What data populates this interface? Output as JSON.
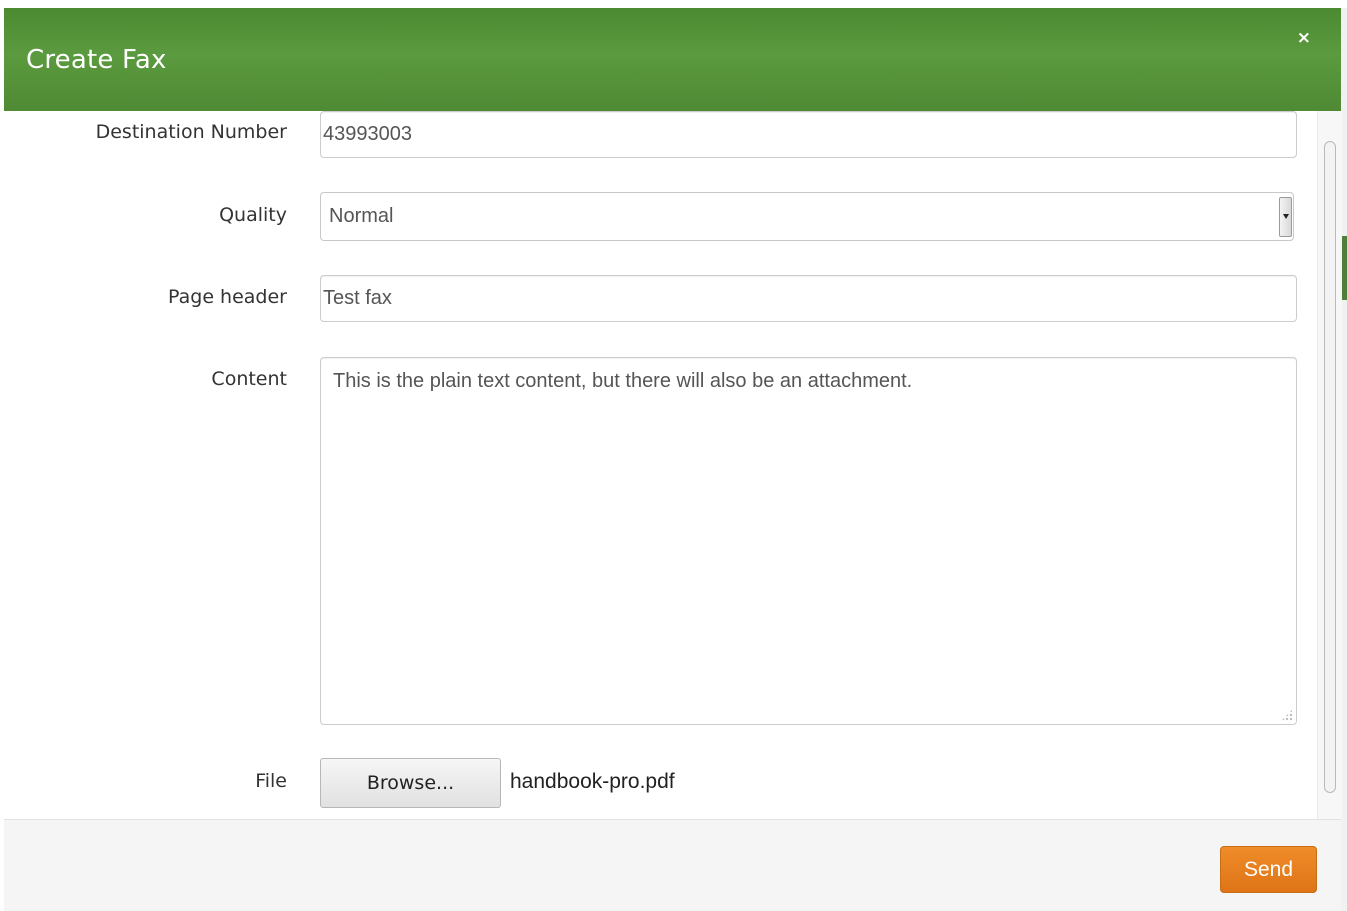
{
  "dialog": {
    "title": "Create Fax",
    "close_label": "×"
  },
  "form": {
    "destination": {
      "label": "Destination Number",
      "value": "43993003"
    },
    "quality": {
      "label": "Quality",
      "selected": "Normal"
    },
    "page_header": {
      "label": "Page header",
      "value": "Test fax"
    },
    "content": {
      "label": "Content",
      "value": "This is the plain text content, but there will also be an attachment."
    },
    "file": {
      "label": "File",
      "browse_label": "Browse...",
      "filename": "handbook-pro.pdf"
    }
  },
  "footer": {
    "send_label": "Send"
  },
  "colors": {
    "header_green": "#5b9a3e",
    "send_orange": "#e67e22"
  }
}
